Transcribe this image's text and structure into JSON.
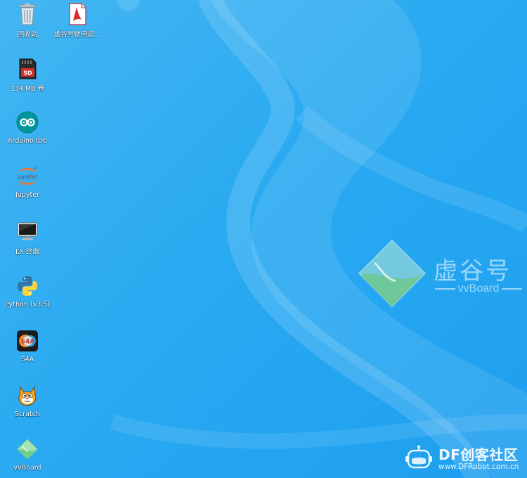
{
  "desktop": {
    "icons": [
      {
        "label": "回收站",
        "icon": "trash-icon"
      },
      {
        "label": "虚谷号使用说…",
        "icon": "pdf-document-icon"
      },
      {
        "label": "134 MB 卷",
        "icon": "sd-card-icon"
      },
      {
        "label": "Arduino IDE",
        "icon": "arduino-icon"
      },
      {
        "label": "Jupyter",
        "icon": "jupyter-icon"
      },
      {
        "label": "LX 终端",
        "icon": "terminal-icon"
      },
      {
        "label": "Python (v3.5)",
        "icon": "python-icon"
      },
      {
        "label": "S4A",
        "icon": "s4a-icon"
      },
      {
        "label": "Scratch",
        "icon": "scratch-cat-icon"
      },
      {
        "label": "vvBoard",
        "icon": "vvboard-icon"
      }
    ]
  },
  "wallpaper": {
    "brand_title": "虚谷号",
    "brand_subtitle": "vvBoard",
    "sd_badge": "SD",
    "jupyter_logo_text": "jupyter",
    "s4a_logo_text": "S4A"
  },
  "watermark": {
    "main": "DF创客社区",
    "url": "www.DFRobot.com.cn"
  },
  "colors": {
    "background": "#2aaaf1",
    "label_text": "#ffffff"
  }
}
